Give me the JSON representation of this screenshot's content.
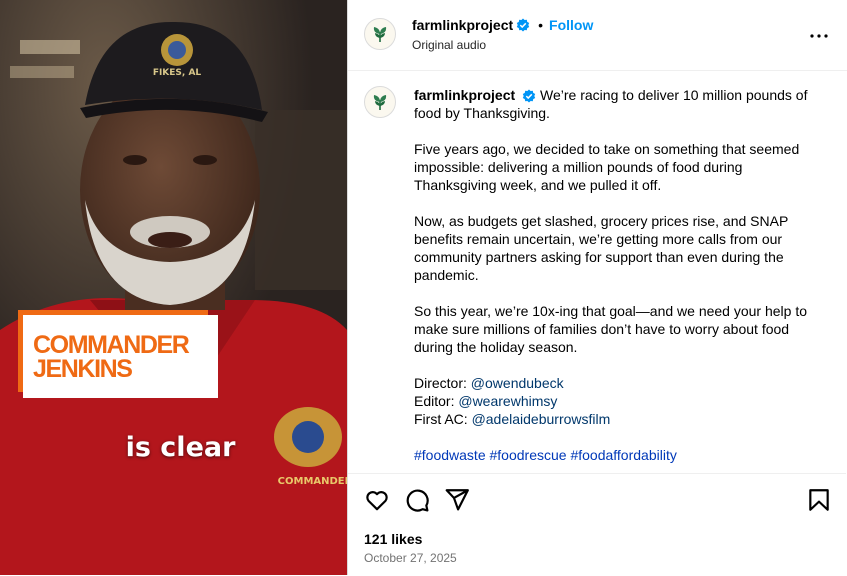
{
  "video": {
    "lower_third_line1": "COMMANDER",
    "lower_third_line2": "JENKINS",
    "subtitle": "is clear",
    "cap_text": "FIKES, AL",
    "patch_text": "COMMANDER",
    "accent_color": "#ef6a14"
  },
  "header": {
    "username": "farmlinkproject",
    "verified_icon": "verified-badge-icon",
    "separator": "•",
    "follow_label": "Follow",
    "audio_label": "Original audio",
    "more_icon": "more-options-icon"
  },
  "post": {
    "username": "farmlinkproject",
    "paragraph1": "We’re racing to deliver 10 million pounds of food by Thanksgiving.",
    "paragraph2": "Five years ago, we decided to take on something that seemed impossible: delivering a million pounds of food during Thanksgiving week, and we pulled it off.",
    "paragraph3": "Now, as budgets get slashed, grocery prices rise, and SNAP benefits remain uncertain, we’re getting more calls from our community partners asking for support than even during the pandemic.",
    "paragraph4": "So this year, we’re 10x-ing that goal—and we need your help to make sure millions of families don’t have to worry about food during the holiday season.",
    "credits": [
      {
        "role": "Director:",
        "handle": "@owendubeck"
      },
      {
        "role": "Editor:",
        "handle": "@wearewhimsy"
      },
      {
        "role": "First AC:",
        "handle": "@adelaideburrowsfilm"
      }
    ],
    "hashtags": [
      "#foodwaste",
      "#foodrescue",
      "#foodaffordability"
    ]
  },
  "actions": {
    "icons": [
      "heart-icon",
      "comment-icon",
      "share-icon",
      "save-icon"
    ],
    "likes": "121 likes",
    "date": "October 27, 2025"
  },
  "colors": {
    "link": "#00376b",
    "hashtag": "#0038b8",
    "follow": "#0095f6",
    "brand_green": "#2e7d4f"
  }
}
